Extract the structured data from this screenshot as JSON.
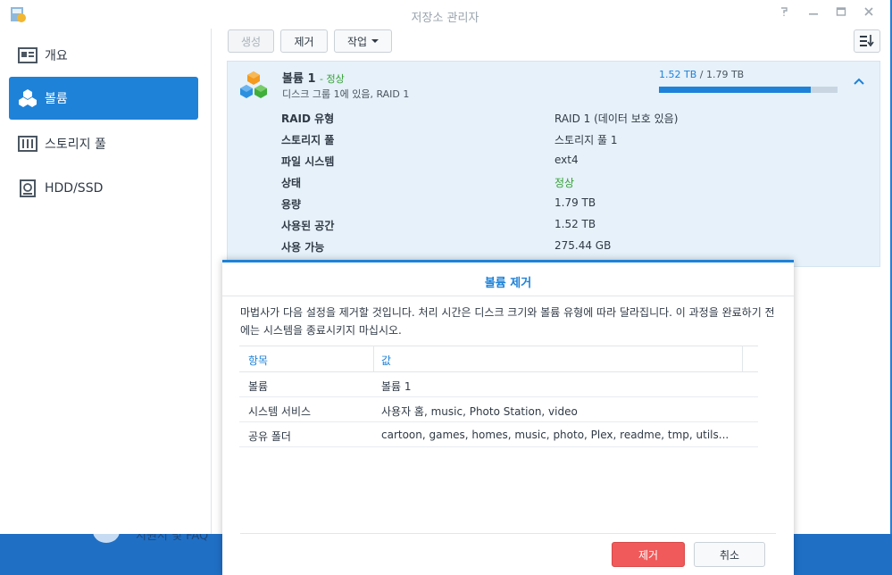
{
  "window": {
    "title": "저장소 관리자"
  },
  "sidebar": {
    "items": [
      {
        "label": "개요",
        "icon": "overview-icon"
      },
      {
        "label": "볼륨",
        "icon": "volume-cubes-icon",
        "active": true
      },
      {
        "label": "스토리지 풀",
        "icon": "storage-pool-icon"
      },
      {
        "label": "HDD/SSD",
        "icon": "hdd-icon"
      }
    ]
  },
  "toolbar": {
    "create_label": "생성",
    "remove_label": "제거",
    "action_label": "작업"
  },
  "volume": {
    "name": "볼륨 1",
    "status": "- 정상",
    "subtitle": "디스크 그룹 1에 있음, RAID 1",
    "used_label": "1.52 TB",
    "total_label": " / 1.79 TB",
    "usage_fraction": 0.85,
    "properties": [
      {
        "key": "RAID 유형",
        "value": "RAID 1 (데이터 보호 있음)"
      },
      {
        "key": "스토리지 풀",
        "value": "스토리지 풀 1"
      },
      {
        "key": "파일 시스템",
        "value": "ext4"
      },
      {
        "key": "상태",
        "value": "정상"
      },
      {
        "key": "용량",
        "value": "1.79 TB"
      },
      {
        "key": "사용된 공간",
        "value": "1.52 TB"
      },
      {
        "key": "사용 가능",
        "value": "275.44 GB"
      }
    ]
  },
  "modal": {
    "title": "볼륨 제거",
    "description": "마법사가 다음 설정을 제거할 것입니다. 처리 시간은 디스크 크기와 볼륨 유형에 따라 달라집니다. 이 과정을 완료하기 전에는 시스템을 종료시키지 마십시오.",
    "columns": [
      "항목",
      "값"
    ],
    "rows": [
      {
        "item": "볼륨",
        "value": "볼륨 1"
      },
      {
        "item": "시스템 서비스",
        "value": "사용자 홈, music, Photo Station, video"
      },
      {
        "item": "공유 폴더",
        "value": "cartoon, games, homes, music, photo, Plex, readme, tmp, utils..."
      }
    ],
    "confirm_label": "제거",
    "cancel_label": "취소"
  },
  "desktop": {
    "help_text": "지원서 및 FAQ"
  },
  "colors": {
    "accent": "#1e82d8",
    "ok": "#34a034",
    "danger": "#f05a5a"
  }
}
